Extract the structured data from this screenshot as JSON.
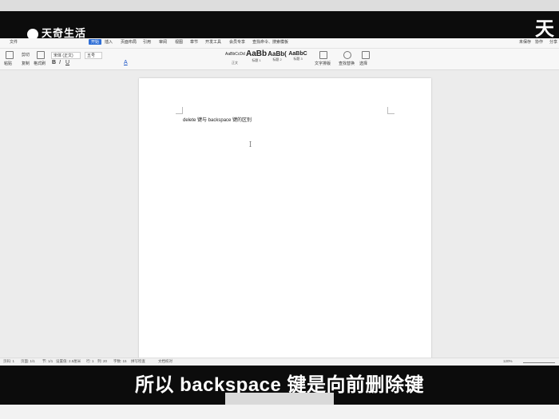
{
  "overlay": {
    "logo_text": "天奇生活",
    "corner_glyph": "天",
    "subtitle": "所以 backspace 键是向前删除键"
  },
  "menubar": {
    "items": [
      "文件",
      "开始",
      "插入",
      "页面布局",
      "引用",
      "审阅",
      "视图",
      "章节",
      "开发工具",
      "会员专享",
      "查找命令、搜索模板"
    ],
    "active": "开始",
    "right_items": [
      "未保存",
      "协作",
      "分享"
    ]
  },
  "toolbar": {
    "paste": "粘贴",
    "cut": "剪切",
    "copy": "复制",
    "format_painter": "格式刷",
    "font_name": "宋体 (正文)",
    "font_size": "五号",
    "styles": [
      {
        "preview": "AaBbCcDd",
        "name": "正文"
      },
      {
        "preview": "AaBb",
        "name": "标题 1"
      },
      {
        "preview": "AaBb(",
        "name": "标题 2"
      },
      {
        "preview": "AaBbC",
        "name": "标题 3"
      }
    ],
    "text_tools": "文字排版",
    "find_replace": "查找替换",
    "select": "选择"
  },
  "document": {
    "text": "delete 键与 backspace 键的区别"
  },
  "statusbar": {
    "page": "页码: 1",
    "pages": "页面: 1/1",
    "section": "节: 1/1",
    "setting": "设置值: 2.5厘米",
    "row": "行: 1",
    "col": "列: 20",
    "words": "字数: 15",
    "spellcheck": "拼写检查",
    "proofing": "文档校对",
    "zoom": "120%"
  }
}
